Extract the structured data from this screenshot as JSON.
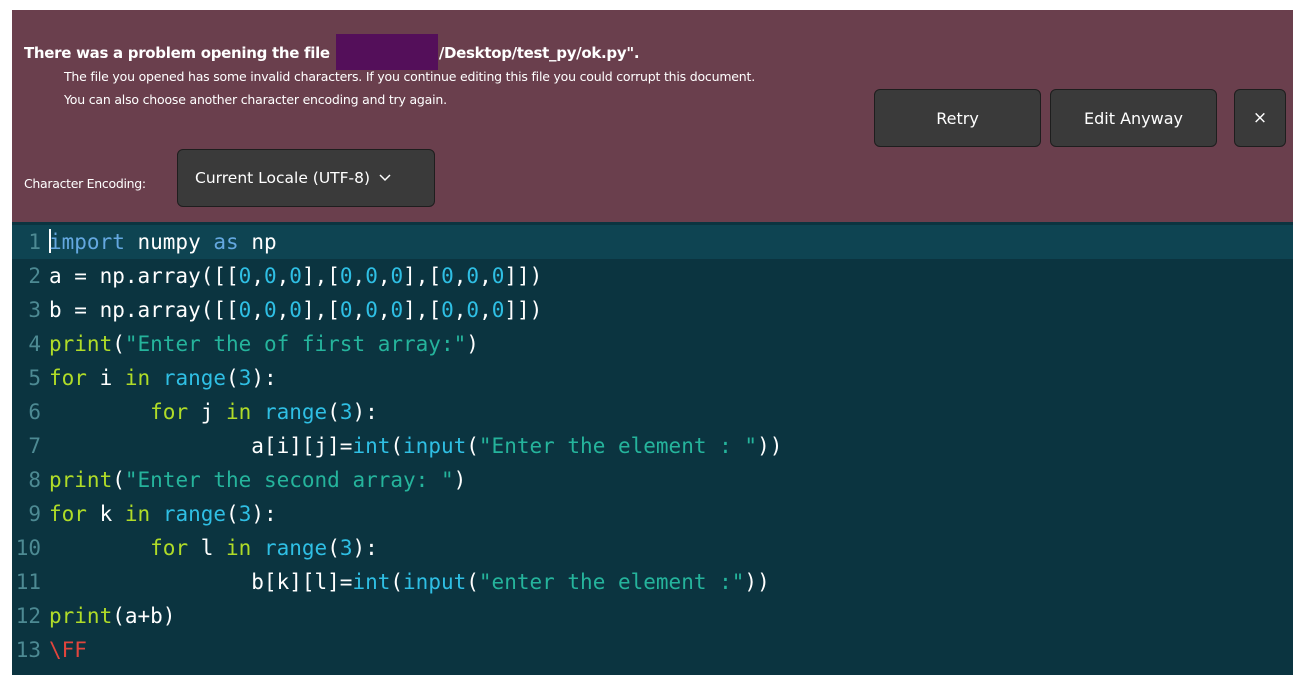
{
  "infobar": {
    "title_pre": "There was a problem opening the file",
    "title_post": "/Desktop/test_py/ok.py\".",
    "message_line1": "The file you opened has some invalid characters. If you continue editing this file you could corrupt this document.",
    "message_line2": "You can also choose another character encoding and try again.",
    "retry_label": "Retry",
    "edit_anyway_label": "Edit Anyway",
    "close_label": "×",
    "encoding_label": "Character Encoding:",
    "encoding_value": "Current Locale (UTF-8)",
    "background_color": "#6a3f4d"
  },
  "editor": {
    "background_color": "#0b3440",
    "current_line_color": "#0e4452",
    "line_numbers": [
      "1",
      "2",
      "3",
      "4",
      "5",
      "6",
      "7",
      "8",
      "9",
      "10",
      "11",
      "12",
      "13"
    ],
    "lines": [
      [
        {
          "t": "import",
          "c": "kw"
        },
        {
          "t": " numpy ",
          "c": ""
        },
        {
          "t": "as",
          "c": "kw"
        },
        {
          "t": " np",
          "c": ""
        }
      ],
      [
        {
          "t": "a = np.array([[",
          "c": ""
        },
        {
          "t": "0",
          "c": "num"
        },
        {
          "t": ",",
          "c": ""
        },
        {
          "t": "0",
          "c": "num"
        },
        {
          "t": ",",
          "c": ""
        },
        {
          "t": "0",
          "c": "num"
        },
        {
          "t": "],[",
          "c": ""
        },
        {
          "t": "0",
          "c": "num"
        },
        {
          "t": ",",
          "c": ""
        },
        {
          "t": "0",
          "c": "num"
        },
        {
          "t": ",",
          "c": ""
        },
        {
          "t": "0",
          "c": "num"
        },
        {
          "t": "],[",
          "c": ""
        },
        {
          "t": "0",
          "c": "num"
        },
        {
          "t": ",",
          "c": ""
        },
        {
          "t": "0",
          "c": "num"
        },
        {
          "t": ",",
          "c": ""
        },
        {
          "t": "0",
          "c": "num"
        },
        {
          "t": "]])",
          "c": ""
        }
      ],
      [
        {
          "t": "b = np.array([[",
          "c": ""
        },
        {
          "t": "0",
          "c": "num"
        },
        {
          "t": ",",
          "c": ""
        },
        {
          "t": "0",
          "c": "num"
        },
        {
          "t": ",",
          "c": ""
        },
        {
          "t": "0",
          "c": "num"
        },
        {
          "t": "],[",
          "c": ""
        },
        {
          "t": "0",
          "c": "num"
        },
        {
          "t": ",",
          "c": ""
        },
        {
          "t": "0",
          "c": "num"
        },
        {
          "t": ",",
          "c": ""
        },
        {
          "t": "0",
          "c": "num"
        },
        {
          "t": "],[",
          "c": ""
        },
        {
          "t": "0",
          "c": "num"
        },
        {
          "t": ",",
          "c": ""
        },
        {
          "t": "0",
          "c": "num"
        },
        {
          "t": ",",
          "c": ""
        },
        {
          "t": "0",
          "c": "num"
        },
        {
          "t": "]])",
          "c": ""
        }
      ],
      [
        {
          "t": "print",
          "c": "ctl"
        },
        {
          "t": "(",
          "c": ""
        },
        {
          "t": "\"Enter the of first array:\"",
          "c": "str"
        },
        {
          "t": ")",
          "c": ""
        }
      ],
      [
        {
          "t": "for",
          "c": "ctl"
        },
        {
          "t": " i ",
          "c": ""
        },
        {
          "t": "in",
          "c": "ctl"
        },
        {
          "t": " ",
          "c": ""
        },
        {
          "t": "range",
          "c": "fn"
        },
        {
          "t": "(",
          "c": ""
        },
        {
          "t": "3",
          "c": "num"
        },
        {
          "t": "):",
          "c": ""
        }
      ],
      [
        {
          "t": "        ",
          "c": ""
        },
        {
          "t": "for",
          "c": "ctl"
        },
        {
          "t": " j ",
          "c": ""
        },
        {
          "t": "in",
          "c": "ctl"
        },
        {
          "t": " ",
          "c": ""
        },
        {
          "t": "range",
          "c": "fn"
        },
        {
          "t": "(",
          "c": ""
        },
        {
          "t": "3",
          "c": "num"
        },
        {
          "t": "):",
          "c": ""
        }
      ],
      [
        {
          "t": "                a[i][j]=",
          "c": ""
        },
        {
          "t": "int",
          "c": "fn"
        },
        {
          "t": "(",
          "c": ""
        },
        {
          "t": "input",
          "c": "fn"
        },
        {
          "t": "(",
          "c": ""
        },
        {
          "t": "\"Enter the element : \"",
          "c": "str"
        },
        {
          "t": "))",
          "c": ""
        }
      ],
      [
        {
          "t": "print",
          "c": "ctl"
        },
        {
          "t": "(",
          "c": ""
        },
        {
          "t": "\"Enter the second array: \"",
          "c": "str"
        },
        {
          "t": ")",
          "c": ""
        }
      ],
      [
        {
          "t": "for",
          "c": "ctl"
        },
        {
          "t": " k ",
          "c": ""
        },
        {
          "t": "in",
          "c": "ctl"
        },
        {
          "t": " ",
          "c": ""
        },
        {
          "t": "range",
          "c": "fn"
        },
        {
          "t": "(",
          "c": ""
        },
        {
          "t": "3",
          "c": "num"
        },
        {
          "t": "):",
          "c": ""
        }
      ],
      [
        {
          "t": "        ",
          "c": ""
        },
        {
          "t": "for",
          "c": "ctl"
        },
        {
          "t": " l ",
          "c": ""
        },
        {
          "t": "in",
          "c": "ctl"
        },
        {
          "t": " ",
          "c": ""
        },
        {
          "t": "range",
          "c": "fn"
        },
        {
          "t": "(",
          "c": ""
        },
        {
          "t": "3",
          "c": "num"
        },
        {
          "t": "):",
          "c": ""
        }
      ],
      [
        {
          "t": "                b[k][l]=",
          "c": ""
        },
        {
          "t": "int",
          "c": "fn"
        },
        {
          "t": "(",
          "c": ""
        },
        {
          "t": "input",
          "c": "fn"
        },
        {
          "t": "(",
          "c": ""
        },
        {
          "t": "\"enter the element :\"",
          "c": "str"
        },
        {
          "t": "))",
          "c": ""
        }
      ],
      [
        {
          "t": "print",
          "c": "ctl"
        },
        {
          "t": "(a+b)",
          "c": ""
        }
      ],
      [
        {
          "t": "\\FF",
          "c": "err"
        }
      ]
    ]
  }
}
